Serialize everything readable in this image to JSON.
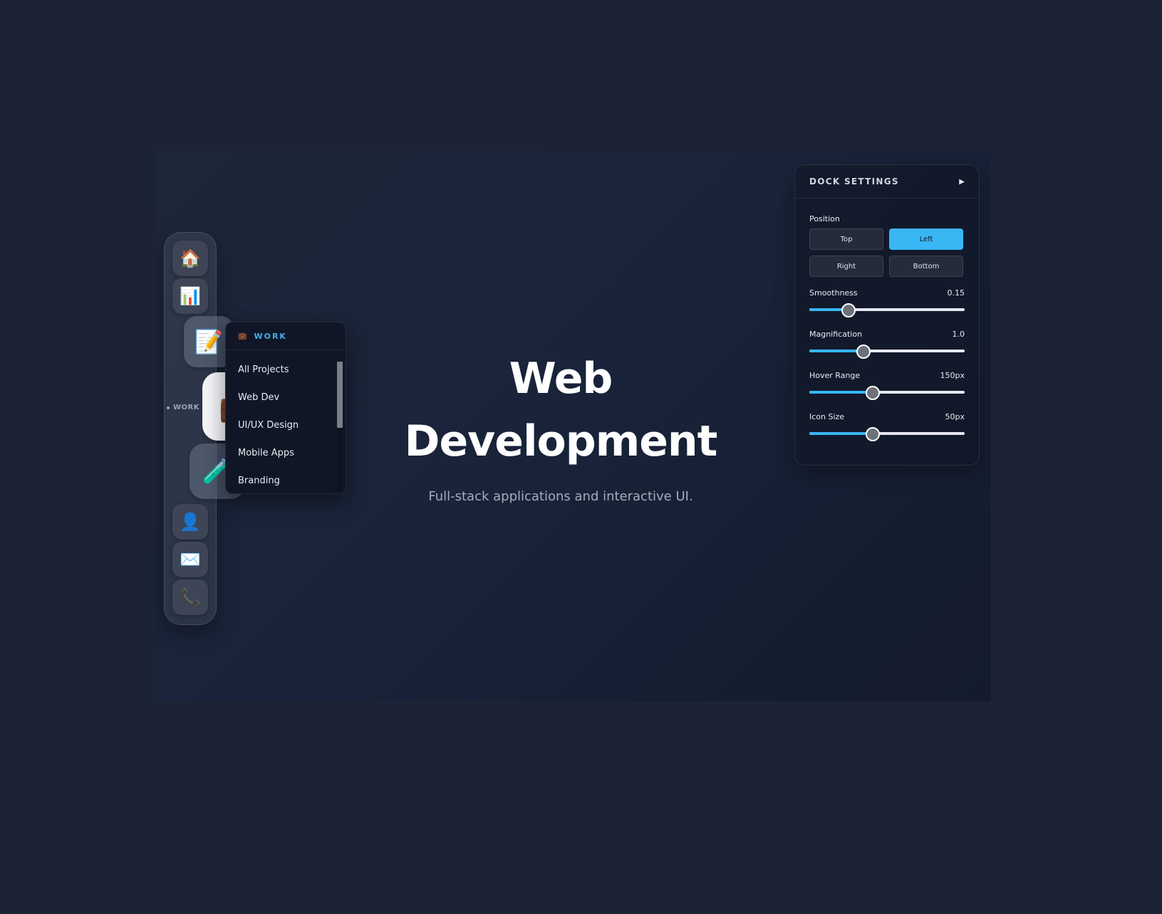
{
  "dock": {
    "items": [
      {
        "icon": "home-icon",
        "glyph": "🏠"
      },
      {
        "icon": "chart-icon",
        "glyph": "📊"
      },
      {
        "icon": "notes-icon",
        "glyph": "📝"
      },
      {
        "icon": "briefcase-icon",
        "glyph": "💼"
      },
      {
        "icon": "tools-icon",
        "glyph": "🧪"
      },
      {
        "icon": "user-icon",
        "glyph": "👤"
      },
      {
        "icon": "mail-icon",
        "glyph": "✉️"
      },
      {
        "icon": "phone-icon",
        "glyph": "📞"
      }
    ],
    "active_label": "WORK"
  },
  "submenu": {
    "title": "WORK",
    "title_icon": "💼",
    "items": [
      "All Projects",
      "Web Dev",
      "UI/UX Design",
      "Mobile Apps",
      "Branding"
    ],
    "scroll_fraction": 0.51
  },
  "hero": {
    "title_line1": "Web",
    "title_line2": "Development",
    "subtitle": "Full-stack applications and interactive UI."
  },
  "settings": {
    "title": "DOCK SETTINGS",
    "toggle_glyph": "▶",
    "position_label": "Position",
    "positions": [
      "Top",
      "Left",
      "Right",
      "Bottom"
    ],
    "selected_position": "Left",
    "sliders": [
      {
        "label": "Smoothness",
        "value_text": "0.15",
        "fraction": 0.25
      },
      {
        "label": "Magnification",
        "value_text": "1.0",
        "fraction": 0.35
      },
      {
        "label": "Hover Range",
        "value_text": "150px",
        "fraction": 0.41
      },
      {
        "label": "Icon Size",
        "value_text": "50px",
        "fraction": 0.41
      }
    ]
  },
  "colors": {
    "accent": "#39b6f4",
    "background": "#1c2335"
  }
}
